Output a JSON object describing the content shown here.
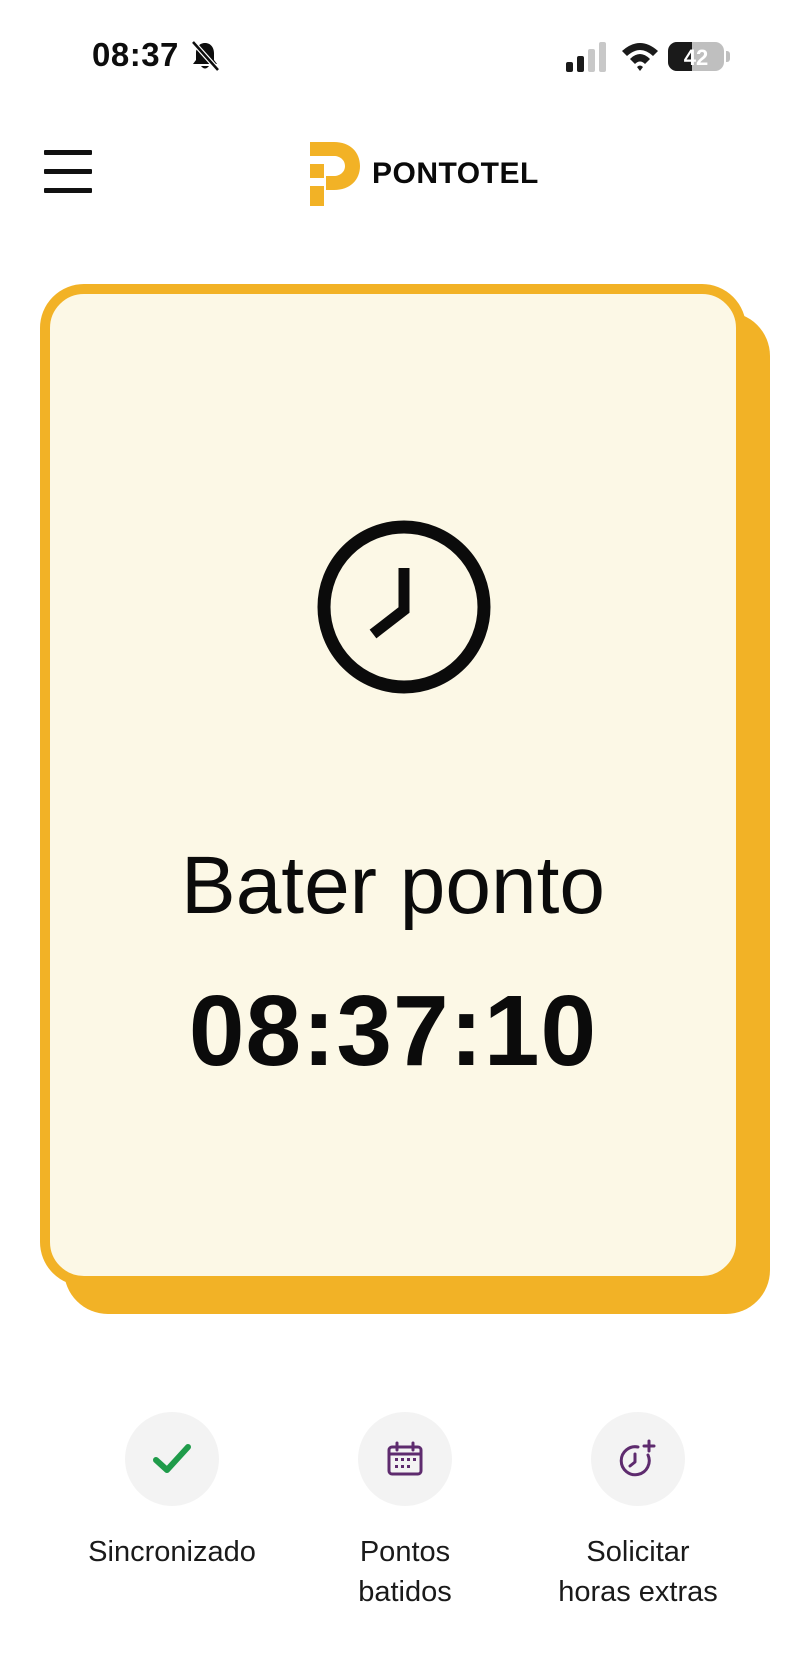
{
  "status_bar": {
    "time": "08:37",
    "battery_level": "42",
    "battery_fraction": 0.42,
    "icons": [
      "bell-off-icon",
      "signal-icon",
      "wifi-icon",
      "battery-icon"
    ]
  },
  "header": {
    "logo_text": "PONTOTEL",
    "menu_icon": "hamburger-menu-icon"
  },
  "card": {
    "icon": "clock-icon",
    "title": "Bater ponto",
    "time": "08:37:10"
  },
  "actions": [
    {
      "icon": "check-icon",
      "label": "Sincronizado"
    },
    {
      "icon": "calendar-icon",
      "label_line1": "Pontos",
      "label_line2": "batidos"
    },
    {
      "icon": "clock-plus-icon",
      "label_line1": "Solicitar",
      "label_line2": "horas extras"
    }
  ],
  "colors": {
    "accent": "#f2b226",
    "card_background": "#fcf8e6",
    "success": "#1f9b4a",
    "purple": "#5e2b6e",
    "circle_background": "#f3f3f3"
  }
}
